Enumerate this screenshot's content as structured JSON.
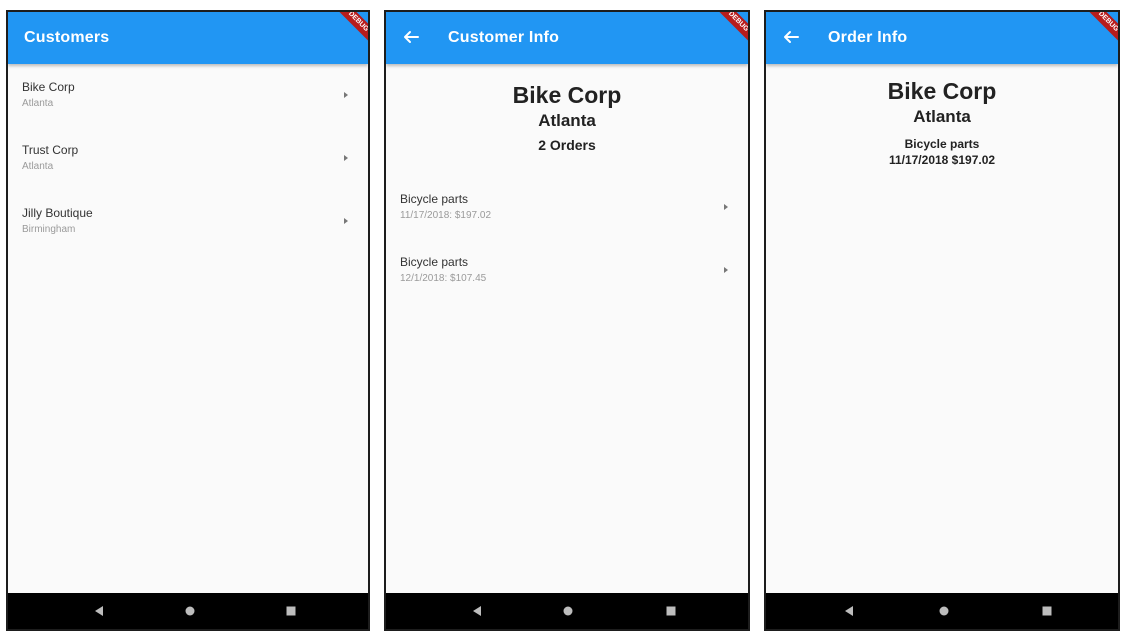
{
  "colors": {
    "app_bar": "#2196f3",
    "app_bar_text": "#ffffff",
    "background": "#fafafa",
    "debug_ribbon": "#b71c1c",
    "nav_bar": "#000000",
    "subtitle_text": "#9a9a9a"
  },
  "debug_banner": "DEBUG",
  "screens": {
    "customers": {
      "title": "Customers",
      "items": [
        {
          "name": "Bike Corp",
          "city": "Atlanta"
        },
        {
          "name": "Trust Corp",
          "city": "Atlanta"
        },
        {
          "name": "Jilly Boutique",
          "city": "Birmingham"
        }
      ]
    },
    "customer_info": {
      "title": "Customer Info",
      "back_icon": "arrow-back-icon",
      "name": "Bike Corp",
      "city": "Atlanta",
      "orders_count": "2 Orders",
      "orders": [
        {
          "description": "Bicycle parts",
          "summary": "11/17/2018: $197.02"
        },
        {
          "description": "Bicycle parts",
          "summary": "12/1/2018: $107.45"
        }
      ]
    },
    "order_info": {
      "title": "Order Info",
      "back_icon": "arrow-back-icon",
      "name": "Bike Corp",
      "city": "Atlanta",
      "description": "Bicycle parts",
      "detail": "11/17/2018 $197.02"
    }
  },
  "nav_icons": [
    "back-triangle-icon",
    "home-circle-icon",
    "recents-square-icon"
  ]
}
